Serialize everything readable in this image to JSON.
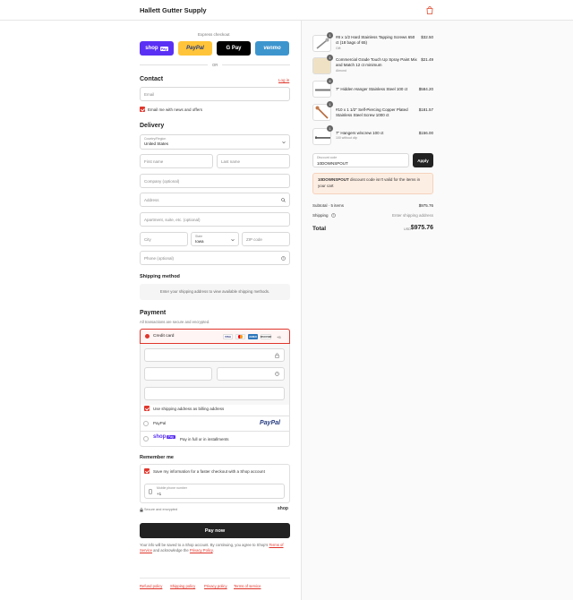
{
  "header": {
    "store_name": "Hallett Gutter Supply",
    "cart_icon": "shopping-bag-icon"
  },
  "express": {
    "title": "Express checkout",
    "buttons": [
      {
        "label": "shop",
        "badge": "Pay",
        "color": "#5a31f4"
      },
      {
        "label": "PayPal",
        "color": "#ffc439"
      },
      {
        "label": "G Pay",
        "color": "#000000"
      },
      {
        "label": "venmo",
        "color": "#3d95ce"
      }
    ],
    "or_label": "OR"
  },
  "contact": {
    "heading": "Contact",
    "login_label": "Log in",
    "email_placeholder": "Email",
    "news_label": "Email me with news and offers"
  },
  "delivery": {
    "heading": "Delivery",
    "country_caption": "Country/Region",
    "country_value": "United States",
    "first_name": "First name",
    "last_name": "Last name",
    "company": "Company (optional)",
    "address": "Address",
    "apartment": "Apartment, suite, etc. (optional)",
    "city": "City",
    "state_caption": "State",
    "state_value": "Iowa",
    "zip": "ZIP code",
    "phone": "Phone (optional)"
  },
  "shipping_method": {
    "heading": "Shipping method",
    "notice": "Enter your shipping address to view available shipping methods."
  },
  "payment": {
    "heading": "Payment",
    "subtitle": "All transactions are secure and encrypted.",
    "credit_card_label": "Credit card",
    "card_logos": [
      "VISA",
      "MC",
      "AMEX",
      "DISCOVER"
    ],
    "more_cards": "+5",
    "billing_label": "Use shipping address as billing address",
    "paypal_label": "PayPal",
    "paypal_logo": "PayPal",
    "shop_pay_label": "Pay in full or in installments",
    "shop_pay_logo": "shop",
    "shop_pay_badge": "Pay"
  },
  "remember": {
    "heading": "Remember me",
    "save_label": "Save my information for a faster checkout with a Shop account",
    "phone_caption": "Mobile phone number",
    "phone_value": "+1",
    "secure_label": "Secure and encrypted",
    "shop_logo": "shop"
  },
  "pay_now_label": "Pay now",
  "legal": {
    "text_1": "Your info will be saved to a Shop account. By continuing, you agree to Shop's",
    "terms_link": "Terms of Service",
    "text_2": "and acknowledge the",
    "privacy_link": "Privacy Policy",
    "text_3": "."
  },
  "footer_links": [
    "Refund policy",
    "Shipping policy",
    "Privacy policy",
    "Terms of service"
  ],
  "order": {
    "items": [
      {
        "qty": "1",
        "name": "#8 x 1/2 Hard Stainless Tapping Screws 650 ct (18 bags of 65)",
        "sub": "Gift",
        "price": "$32.50"
      },
      {
        "qty": "1",
        "name": "Commercial Grade Touch Up Spray Paint Mix and Match 12 ct minimum",
        "sub": "Almond",
        "price": "$21.49"
      },
      {
        "qty": "4",
        "name": "7\" Hidden Hanger Stainless Steel 100 ct",
        "sub": "",
        "price": "$584.20"
      },
      {
        "qty": "1",
        "name": "#10 x 1 1/2\" Self-Piercing Copper Plated Stainless Steel Screw 1000 ct",
        "sub": "",
        "price": "$181.57"
      },
      {
        "qty": "1",
        "name": "7\" Hangers w/screw 100 ct",
        "sub": "100 without clip",
        "price": "$156.00"
      }
    ],
    "discount_caption": "Discount code",
    "discount_value": "10DOWNSPOUT",
    "apply_label": "Apply",
    "discount_error_code": "10DOWNSPOUT",
    "discount_error": "discount code isn't valid for the items in your cart",
    "subtotal_label": "Subtotal · 5 items",
    "subtotal_value": "$975.76",
    "shipping_label": "Shipping",
    "shipping_value": "Enter shipping address",
    "total_label": "Total",
    "currency": "USD",
    "total_value": "$975.76"
  }
}
